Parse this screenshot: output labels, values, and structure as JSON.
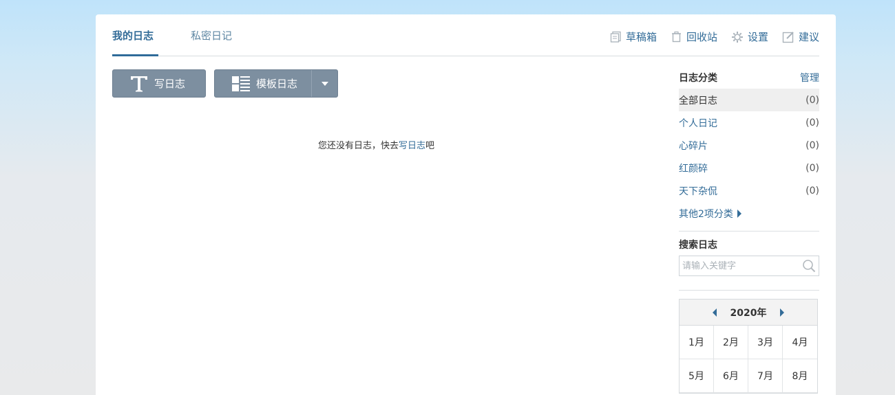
{
  "tabs": [
    {
      "label": "我的日志"
    },
    {
      "label": "私密日记"
    }
  ],
  "top_links": [
    {
      "label": "草稿箱",
      "icon": "drafts-icon"
    },
    {
      "label": "回收站",
      "icon": "trash-icon"
    },
    {
      "label": "设置",
      "icon": "gear-icon"
    },
    {
      "label": "建议",
      "icon": "edit-icon"
    }
  ],
  "toolbar": {
    "write_label": "写日志",
    "template_label": "模板日志"
  },
  "empty": {
    "before": "您还没有日志，快去",
    "link": "写日志",
    "after": "吧"
  },
  "sidebar": {
    "title": "日志分类",
    "manage": "管理",
    "categories": [
      {
        "name": "全部日志",
        "count": "(0)"
      },
      {
        "name": "个人日记",
        "count": "(0)"
      },
      {
        "name": "心碎片",
        "count": "(0)"
      },
      {
        "name": "红颜碎",
        "count": "(0)"
      },
      {
        "name": "天下杂侃",
        "count": "(0)"
      }
    ],
    "more": "其他2项分类",
    "search_title": "搜索日志",
    "search_placeholder": "请输入关键字"
  },
  "calendar": {
    "year": "2020年",
    "months": [
      "1月",
      "2月",
      "3月",
      "4月",
      "5月",
      "6月",
      "7月",
      "8月"
    ]
  },
  "colors": {
    "accent": "#336c98",
    "button": "#7d8fa0"
  }
}
